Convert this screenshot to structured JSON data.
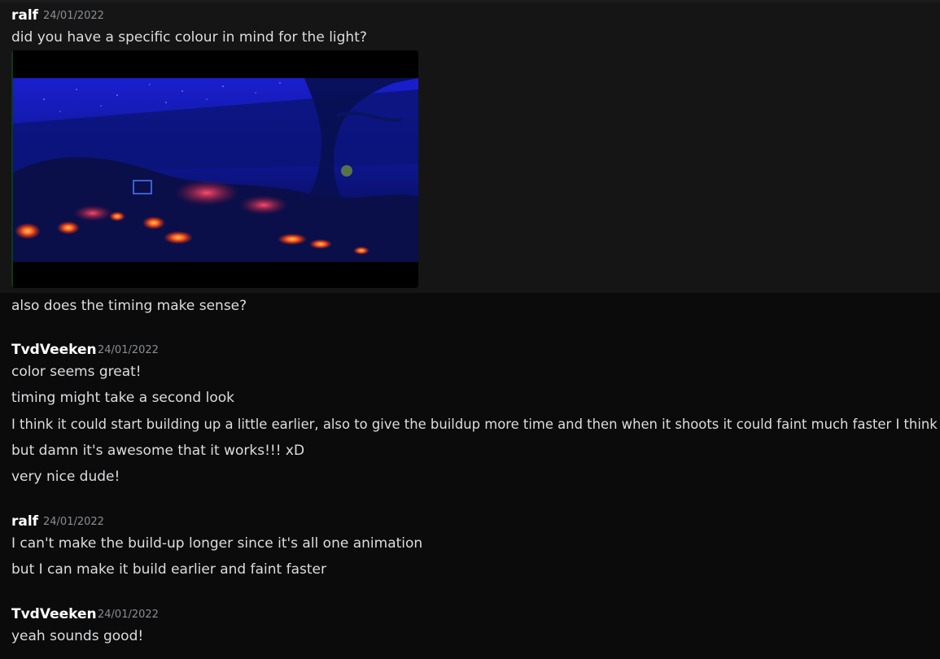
{
  "messages": [
    {
      "author": "ralf",
      "timestamp": "24/01/2022",
      "lines": [
        "did you have a specific colour in mind for the light?"
      ],
      "attachment": {
        "type": "image",
        "description_icon": "screenshot-image"
      },
      "after_lines": [
        "also does the timing make sense?"
      ]
    },
    {
      "author": "TvdVeeken",
      "timestamp": "24/01/2022",
      "lines": [
        "color seems great!",
        "timing might take a second look",
        "I think it could start building up a little earlier, also to give the buildup more time and then when it shoots it could faint much faster I think",
        "but damn it's awesome that it works!!! xD",
        "very nice dude!"
      ]
    },
    {
      "author": "ralf",
      "timestamp": "24/01/2022",
      "lines": [
        "I can't make the build-up longer since it's all one animation",
        "but I can make it build earlier and faint faster"
      ]
    },
    {
      "author": "TvdVeeken",
      "timestamp": "24/01/2022",
      "lines": [
        "yeah sounds good!"
      ]
    }
  ],
  "colors": {
    "background": "#0b0b0c",
    "highlight": "#151516",
    "text": "#dcddde",
    "username": "#ffffff",
    "timestamp": "#8b8d92"
  }
}
